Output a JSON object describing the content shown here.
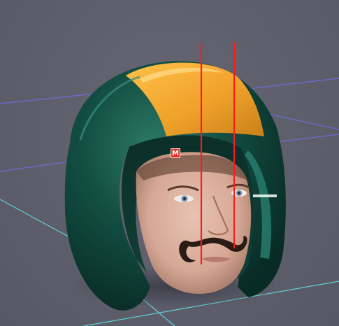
{
  "viewport": {
    "background_color": "#5e5f6b",
    "grid_colors": {
      "x_axis_line": "#6b6bd6",
      "z_axis_line": "#5fd0d8"
    },
    "guide_line_color": "#ff1a1a"
  },
  "model": {
    "helmet_primary_color": "#0f4a3f",
    "helmet_stripe_color": "#f0a830",
    "marker_label": "M",
    "marker_color": "#e0302a",
    "mustache_color": "#2a1c15"
  }
}
